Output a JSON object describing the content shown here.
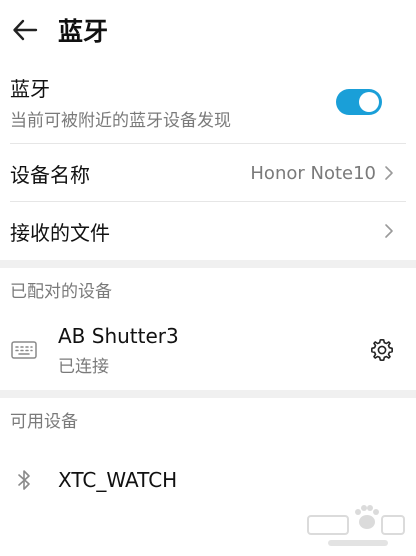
{
  "header": {
    "title": "蓝牙",
    "back_icon": "arrow-left-icon"
  },
  "bluetooth": {
    "label": "蓝牙",
    "description": "当前可被附近的蓝牙设备发现",
    "enabled": true,
    "accent_color": "#1a9fd8"
  },
  "device_name": {
    "label": "设备名称",
    "value": "Honor Note10"
  },
  "received_files": {
    "label": "接收的文件"
  },
  "paired": {
    "section_label": "已配对的设备",
    "devices": [
      {
        "name": "AB Shutter3",
        "status": "已连接",
        "icon": "keyboard-icon"
      }
    ]
  },
  "available": {
    "section_label": "可用设备",
    "devices": [
      {
        "name": "XTC_WATCH",
        "icon": "bluetooth-icon"
      }
    ]
  },
  "watermark": {
    "icon": "baidu-jingyan-watermark"
  }
}
